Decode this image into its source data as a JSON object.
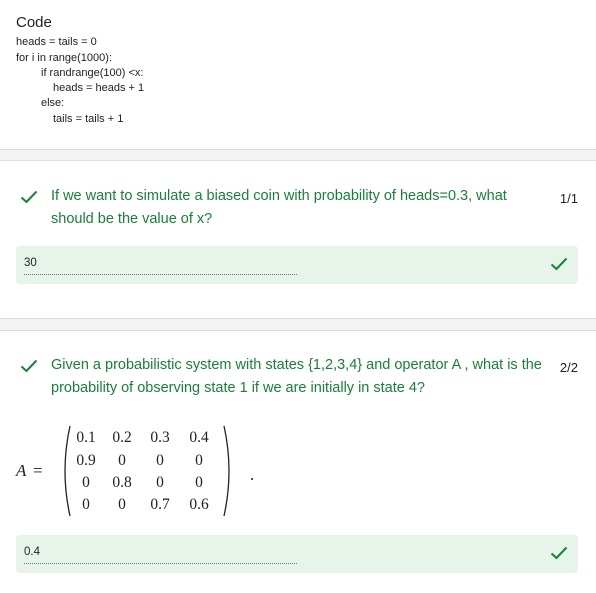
{
  "code_card": {
    "title": "Code",
    "lines": [
      "heads = tails = 0",
      "for i in range(1000):",
      "if randrange(100) <x:",
      "heads = heads + 1",
      "else:",
      "tails = tails + 1"
    ]
  },
  "questions": [
    {
      "text": "If we want to simulate a biased coin with probability of heads=0.3, what should be the value of x?",
      "score": "1/1",
      "answer": "30"
    },
    {
      "text": "Given a probabilistic system with states {1,2,3,4} and operator A , what is the probability of observing state 1 if we are initially in state 4?",
      "score": "2/2",
      "answer": "0.4",
      "matrix": {
        "label": "A",
        "equals": "=",
        "trailing": ".",
        "rows": [
          [
            "0.1",
            "0.2",
            "0.3",
            "0.4"
          ],
          [
            "0.9",
            "0",
            "0",
            "0"
          ],
          [
            "0",
            "0.8",
            "0",
            "0"
          ],
          [
            "0",
            "0",
            "0.7",
            "0.6"
          ]
        ]
      }
    }
  ],
  "colors": {
    "correct_green": "#188038",
    "answer_bg": "#e6f4ea",
    "separator_bg": "#f1f3f4"
  }
}
